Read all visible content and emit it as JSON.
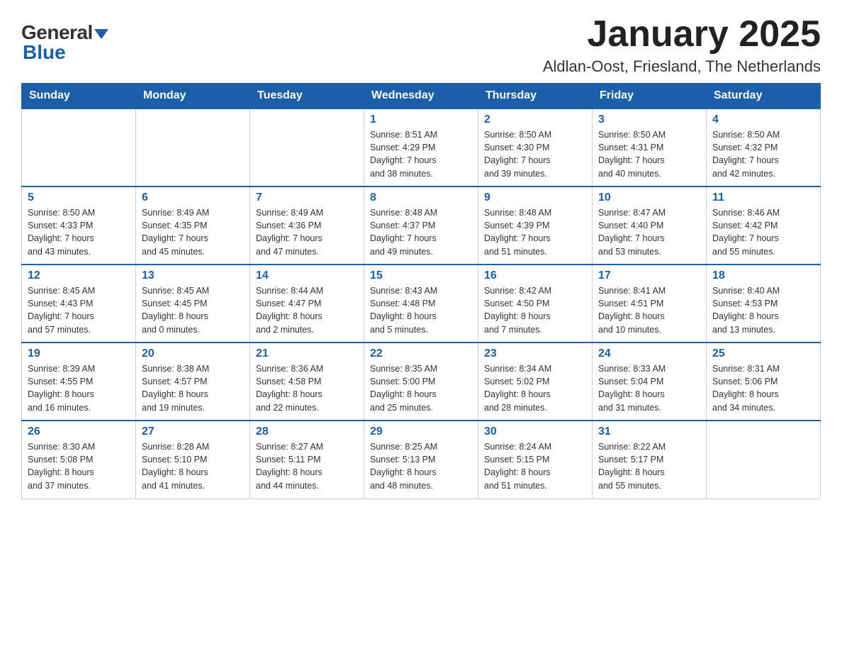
{
  "logo": {
    "general": "General",
    "triangle": "",
    "blue": "Blue"
  },
  "title": "January 2025",
  "subtitle": "Aldlan-Oost, Friesland, The Netherlands",
  "days_of_week": [
    "Sunday",
    "Monday",
    "Tuesday",
    "Wednesday",
    "Thursday",
    "Friday",
    "Saturday"
  ],
  "weeks": [
    [
      {
        "day": "",
        "info": ""
      },
      {
        "day": "",
        "info": ""
      },
      {
        "day": "",
        "info": ""
      },
      {
        "day": "1",
        "info": "Sunrise: 8:51 AM\nSunset: 4:29 PM\nDaylight: 7 hours\nand 38 minutes."
      },
      {
        "day": "2",
        "info": "Sunrise: 8:50 AM\nSunset: 4:30 PM\nDaylight: 7 hours\nand 39 minutes."
      },
      {
        "day": "3",
        "info": "Sunrise: 8:50 AM\nSunset: 4:31 PM\nDaylight: 7 hours\nand 40 minutes."
      },
      {
        "day": "4",
        "info": "Sunrise: 8:50 AM\nSunset: 4:32 PM\nDaylight: 7 hours\nand 42 minutes."
      }
    ],
    [
      {
        "day": "5",
        "info": "Sunrise: 8:50 AM\nSunset: 4:33 PM\nDaylight: 7 hours\nand 43 minutes."
      },
      {
        "day": "6",
        "info": "Sunrise: 8:49 AM\nSunset: 4:35 PM\nDaylight: 7 hours\nand 45 minutes."
      },
      {
        "day": "7",
        "info": "Sunrise: 8:49 AM\nSunset: 4:36 PM\nDaylight: 7 hours\nand 47 minutes."
      },
      {
        "day": "8",
        "info": "Sunrise: 8:48 AM\nSunset: 4:37 PM\nDaylight: 7 hours\nand 49 minutes."
      },
      {
        "day": "9",
        "info": "Sunrise: 8:48 AM\nSunset: 4:39 PM\nDaylight: 7 hours\nand 51 minutes."
      },
      {
        "day": "10",
        "info": "Sunrise: 8:47 AM\nSunset: 4:40 PM\nDaylight: 7 hours\nand 53 minutes."
      },
      {
        "day": "11",
        "info": "Sunrise: 8:46 AM\nSunset: 4:42 PM\nDaylight: 7 hours\nand 55 minutes."
      }
    ],
    [
      {
        "day": "12",
        "info": "Sunrise: 8:45 AM\nSunset: 4:43 PM\nDaylight: 7 hours\nand 57 minutes."
      },
      {
        "day": "13",
        "info": "Sunrise: 8:45 AM\nSunset: 4:45 PM\nDaylight: 8 hours\nand 0 minutes."
      },
      {
        "day": "14",
        "info": "Sunrise: 8:44 AM\nSunset: 4:47 PM\nDaylight: 8 hours\nand 2 minutes."
      },
      {
        "day": "15",
        "info": "Sunrise: 8:43 AM\nSunset: 4:48 PM\nDaylight: 8 hours\nand 5 minutes."
      },
      {
        "day": "16",
        "info": "Sunrise: 8:42 AM\nSunset: 4:50 PM\nDaylight: 8 hours\nand 7 minutes."
      },
      {
        "day": "17",
        "info": "Sunrise: 8:41 AM\nSunset: 4:51 PM\nDaylight: 8 hours\nand 10 minutes."
      },
      {
        "day": "18",
        "info": "Sunrise: 8:40 AM\nSunset: 4:53 PM\nDaylight: 8 hours\nand 13 minutes."
      }
    ],
    [
      {
        "day": "19",
        "info": "Sunrise: 8:39 AM\nSunset: 4:55 PM\nDaylight: 8 hours\nand 16 minutes."
      },
      {
        "day": "20",
        "info": "Sunrise: 8:38 AM\nSunset: 4:57 PM\nDaylight: 8 hours\nand 19 minutes."
      },
      {
        "day": "21",
        "info": "Sunrise: 8:36 AM\nSunset: 4:58 PM\nDaylight: 8 hours\nand 22 minutes."
      },
      {
        "day": "22",
        "info": "Sunrise: 8:35 AM\nSunset: 5:00 PM\nDaylight: 8 hours\nand 25 minutes."
      },
      {
        "day": "23",
        "info": "Sunrise: 8:34 AM\nSunset: 5:02 PM\nDaylight: 8 hours\nand 28 minutes."
      },
      {
        "day": "24",
        "info": "Sunrise: 8:33 AM\nSunset: 5:04 PM\nDaylight: 8 hours\nand 31 minutes."
      },
      {
        "day": "25",
        "info": "Sunrise: 8:31 AM\nSunset: 5:06 PM\nDaylight: 8 hours\nand 34 minutes."
      }
    ],
    [
      {
        "day": "26",
        "info": "Sunrise: 8:30 AM\nSunset: 5:08 PM\nDaylight: 8 hours\nand 37 minutes."
      },
      {
        "day": "27",
        "info": "Sunrise: 8:28 AM\nSunset: 5:10 PM\nDaylight: 8 hours\nand 41 minutes."
      },
      {
        "day": "28",
        "info": "Sunrise: 8:27 AM\nSunset: 5:11 PM\nDaylight: 8 hours\nand 44 minutes."
      },
      {
        "day": "29",
        "info": "Sunrise: 8:25 AM\nSunset: 5:13 PM\nDaylight: 8 hours\nand 48 minutes."
      },
      {
        "day": "30",
        "info": "Sunrise: 8:24 AM\nSunset: 5:15 PM\nDaylight: 8 hours\nand 51 minutes."
      },
      {
        "day": "31",
        "info": "Sunrise: 8:22 AM\nSunset: 5:17 PM\nDaylight: 8 hours\nand 55 minutes."
      },
      {
        "day": "",
        "info": ""
      }
    ]
  ]
}
